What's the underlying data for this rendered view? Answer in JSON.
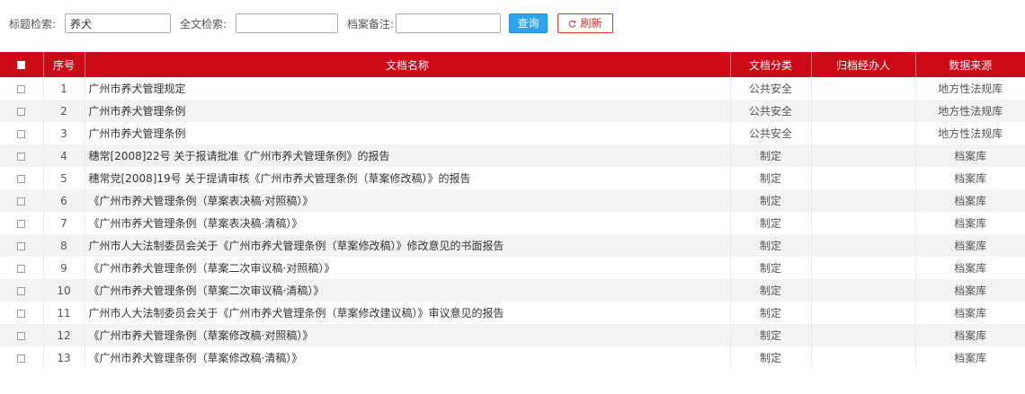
{
  "search": {
    "title_label": "标题检索:",
    "title_value": "养犬",
    "fulltext_label": "全文检索:",
    "fulltext_value": "",
    "remark_label": "档案备注:",
    "remark_value": "",
    "query_button": "查询",
    "refresh_button": "刷新"
  },
  "table": {
    "columns": {
      "no": "序号",
      "title": "文档名称",
      "category": "文档分类",
      "handler": "归档经办人",
      "source": "数据来源"
    },
    "rows": [
      {
        "no": "1",
        "title": "广州市养犬管理规定",
        "category": "公共安全",
        "handler": "",
        "source": "地方性法规库"
      },
      {
        "no": "2",
        "title": "广州市养犬管理条例",
        "category": "公共安全",
        "handler": "",
        "source": "地方性法规库"
      },
      {
        "no": "3",
        "title": "广州市养犬管理条例",
        "category": "公共安全",
        "handler": "",
        "source": "地方性法规库"
      },
      {
        "no": "4",
        "title": "穗常[2008]22号 关于报请批准《广州市养犬管理条例》的报告",
        "category": "制定",
        "handler": "",
        "source": "档案库"
      },
      {
        "no": "5",
        "title": "穗常党[2008]19号 关于提请审核《广州市养犬管理条例（草案修改稿）》的报告",
        "category": "制定",
        "handler": "",
        "source": "档案库"
      },
      {
        "no": "6",
        "title": "《广州市养犬管理条例（草案表决稿·对照稿）》",
        "category": "制定",
        "handler": "",
        "source": "档案库"
      },
      {
        "no": "7",
        "title": "《广州市养犬管理条例（草案表决稿·清稿）》",
        "category": "制定",
        "handler": "",
        "source": "档案库"
      },
      {
        "no": "8",
        "title": "广州市人大法制委员会关于《广州市养犬管理条例（草案修改稿）》修改意见的书面报告",
        "category": "制定",
        "handler": "",
        "source": "档案库"
      },
      {
        "no": "9",
        "title": "《广州市养犬管理条例（草案二次审议稿·对照稿）》",
        "category": "制定",
        "handler": "",
        "source": "档案库"
      },
      {
        "no": "10",
        "title": "《广州市养犬管理条例（草案二次审议稿·清稿）》",
        "category": "制定",
        "handler": "",
        "source": "档案库"
      },
      {
        "no": "11",
        "title": "广州市人大法制委员会关于《广州市养犬管理条例（草案修改建议稿）》审议意见的报告",
        "category": "制定",
        "handler": "",
        "source": "档案库"
      },
      {
        "no": "12",
        "title": "《广州市养犬管理条例（草案修改稿·对照稿）》",
        "category": "制定",
        "handler": "",
        "source": "档案库"
      },
      {
        "no": "13",
        "title": "《广州市养犬管理条例（草案修改稿·清稿）》",
        "category": "制定",
        "handler": "",
        "source": "档案库"
      }
    ]
  },
  "icons": {
    "refresh": "refresh-icon",
    "checkbox": "checkbox-icon"
  },
  "colors": {
    "header_bg": "#cc0a17",
    "query_button_bg": "#2ea2ec",
    "refresh_button_border": "#d9322f",
    "row_stripe": "#f3f3f3"
  }
}
